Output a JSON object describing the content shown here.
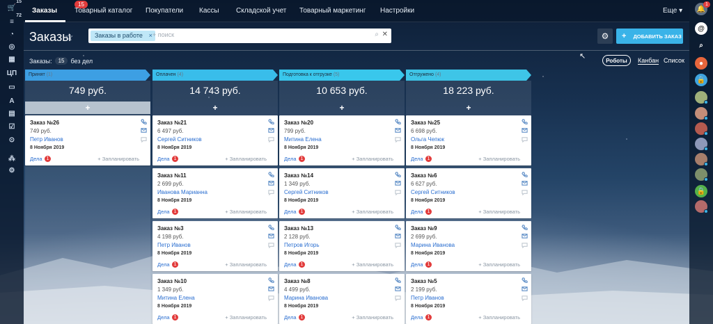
{
  "colors": {
    "accent": "#3ab3e8",
    "badge_red": "#e23b3b",
    "stages": [
      "#3d9fe3",
      "#39bdea",
      "#39c7ec",
      "#3ec5e7"
    ]
  },
  "left_rail": {
    "counts": [
      "15",
      "72"
    ],
    "label_cp": "ЦП",
    "label_a": "A",
    "icons": [
      "cart-icon",
      "filter-icon",
      "chart-icon",
      "target-icon",
      "grid-icon",
      "cp-label",
      "window-icon",
      "a-label",
      "book-icon",
      "check-icon",
      "circle-down-icon",
      "sitemap-icon",
      "settings-icon"
    ]
  },
  "right_rail": {
    "notifications_badge": "1",
    "icons": [
      "bell-icon",
      "at-icon",
      "search-icon",
      "user-icon",
      "lock-icon",
      "avatar",
      "avatar",
      "avatar",
      "avatar",
      "avatar",
      "avatar",
      "lock-icon",
      "avatar"
    ]
  },
  "topnav": {
    "tabs": [
      {
        "label": "Заказы",
        "count": "15"
      },
      {
        "label": "Товарный каталог"
      },
      {
        "label": "Покупатели"
      },
      {
        "label": "Кассы"
      },
      {
        "label": "Складской учет"
      },
      {
        "label": "Товарный маркетинг"
      },
      {
        "label": "Настройки"
      }
    ],
    "more_label": "Еще ▾"
  },
  "header": {
    "title": "Заказы",
    "filter_tag": "Заказы в работе",
    "search_placeholder": "+ поиск",
    "add_button_label": "ДОБАВИТЬ ЗАКАЗ"
  },
  "summary": {
    "label": "Заказы:",
    "count": "15",
    "without_tasks": "без дел"
  },
  "toolbar": {
    "robots_label": "Роботы",
    "view_kanban": "Канбан",
    "view_list": "Список"
  },
  "kanban": {
    "tasks_label": "Дела",
    "plan_label": "+ Запланировать",
    "columns": [
      {
        "name": "Принят",
        "count": "(1)",
        "sum": "749 руб.",
        "cards": [
          {
            "title": "Заказ №26",
            "price": "749 руб.",
            "client": "Петр Иванов",
            "date": "8 Ноября 2019",
            "tasks": "1"
          }
        ]
      },
      {
        "name": "Оплачен",
        "count": "(4)",
        "sum": "14 743 руб.",
        "cards": [
          {
            "title": "Заказ №21",
            "price": "6 497 руб.",
            "client": "Сергей Ситников",
            "date": "8 Ноября 2019",
            "tasks": "1"
          },
          {
            "title": "Заказ №11",
            "price": "2 699 руб.",
            "client": "Иванова Марианна",
            "date": "8 Ноября 2019",
            "tasks": "1"
          },
          {
            "title": "Заказ №3",
            "price": "4 198 руб.",
            "client": "Петр Иванов",
            "date": "8 Ноября 2019",
            "tasks": "1"
          },
          {
            "title": "Заказ №10",
            "price": "1 349 руб.",
            "client": "Митина Елена",
            "date": "8 Ноября 2019",
            "tasks": "1"
          }
        ]
      },
      {
        "name": "Подготовка к отгрузке",
        "count": "(5)",
        "sum": "10 653 руб.",
        "cards": [
          {
            "title": "Заказ №20",
            "price": "799 руб.",
            "client": "Митина Елена",
            "date": "8 Ноября 2019",
            "tasks": "1"
          },
          {
            "title": "Заказ №14",
            "price": "1 349 руб.",
            "client": "Сергей Ситников",
            "date": "8 Ноября 2019",
            "tasks": "1"
          },
          {
            "title": "Заказ №13",
            "price": "2 128 руб.",
            "client": "Петров Игорь",
            "date": "8 Ноября 2019",
            "tasks": "1"
          },
          {
            "title": "Заказ №8",
            "price": "4 499 руб.",
            "client": "Марина Иванова",
            "date": "8 Ноября 2019",
            "tasks": "1"
          }
        ]
      },
      {
        "name": "Отгружено",
        "count": "(4)",
        "sum": "18 223 руб.",
        "cards": [
          {
            "title": "Заказ №25",
            "price": "6 698 руб.",
            "client": "Ольга Чепюк",
            "date": "8 Ноября 2019",
            "tasks": "1"
          },
          {
            "title": "Заказ №6",
            "price": "6 627 руб.",
            "client": "Сергей Ситников",
            "date": "8 Ноября 2019",
            "tasks": "1"
          },
          {
            "title": "Заказ №9",
            "price": "2 699 руб.",
            "client": "Марина Иванова",
            "date": "8 Ноября 2019",
            "tasks": "1"
          },
          {
            "title": "Заказ №5",
            "price": "2 199 руб.",
            "client": "Петр Иванов",
            "date": "8 Ноября 2019",
            "tasks": "1"
          }
        ]
      }
    ]
  }
}
